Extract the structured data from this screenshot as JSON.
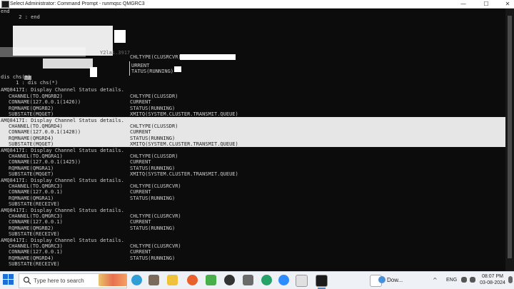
{
  "window": {
    "title": "Select Administrator: Command Prompt - runmqsc  QMGRC3",
    "minimize": "—",
    "maximize": "☐",
    "close": "✕"
  },
  "console": {
    "lines_top": [
      "end",
      "      2 : end",
      "dis chs(*)",
      "     1 : dis chs(*)",
      "AMQ8417I: Display Channel Status details."
    ],
    "blocks": [
      {
        "header": "AMQ8417I: Display Channel Status details.",
        "left": [
          "CHANNEL(TO.QMGRB2)",
          "CONNAME(127.0.0.1(1426))",
          "RQMNAME(QMGRB2)",
          "SUBSTATE(MQGET)"
        ],
        "right": [
          "CHLTYPE(CLUSSDR)",
          "CURRENT",
          "STATUS(RUNNING)",
          "XMITQ(SYSTEM.CLUSTER.TRANSMIT.QUEUE)"
        ]
      },
      {
        "header": "AMQ8417I: Display Channel Status details.",
        "left": [
          "CHANNEL(TO.QMGRD4)",
          "CONNAME(127.0.0.1(1428))",
          "RQMNAME(QMGRD4)",
          "SUBSTATE(MQGET)"
        ],
        "right": [
          "CHLTYPE(CLUSSDR)",
          "CURRENT",
          "STATUS(RUNNING)",
          "XMITQ(SYSTEM.CLUSTER.TRANSMIT.QUEUE)"
        ]
      },
      {
        "header": "AMQ8417I: Display Channel Status details.",
        "left": [
          "CHANNEL(TO.QMGRA1)",
          "CONNAME(127.0.0.1(1425))",
          "RQMNAME(QMGRA1)",
          "SUBSTATE(MQGET)"
        ],
        "right": [
          "CHLTYPE(CLUSSDR)",
          "CURRENT",
          "STATUS(RUNNING)",
          "XMITQ(SYSTEM.CLUSTER.TRANSMIT.QUEUE)"
        ]
      },
      {
        "header": "AMQ8417I: Display Channel Status details.",
        "left": [
          "CHANNEL(TO.QMGRC3)",
          "CONNAME(127.0.0.1)",
          "RQMNAME(QMGRA1)",
          "SUBSTATE(RECEIVE)"
        ],
        "right": [
          "CHLTYPE(CLUSRCVR)",
          "CURRENT",
          "STATUS(RUNNING)",
          ""
        ]
      },
      {
        "header": "AMQ8417I: Display Channel Status details.",
        "left": [
          "CHANNEL(TO.QMGRC3)",
          "CONNAME(127.0.0.1)",
          "RQMNAME(QMGRB2)",
          "SUBSTATE(RECEIVE)"
        ],
        "right": [
          "CHLTYPE(CLUSRCVR)",
          "CURRENT",
          "STATUS(RUNNING)",
          ""
        ]
      },
      {
        "header": "AMQ8417I: Display Channel Status details.",
        "left": [
          "CHANNEL(TO.QMGRC3)",
          "CONNAME(127.0.0.1)",
          "RQMNAME(QMGRD4)",
          "SUBSTATE(RECEIVE)"
        ],
        "right": [
          "CHLTYPE(CLUSRCVR)",
          "CURRENT",
          "STATUS(RUNNING)",
          ""
        ]
      }
    ],
    "partial": {
      "right_top": [
        "CHLTYPE(CLUSRCVR)",
        "URRENT",
        "TATUS(RUNNING)"
      ],
      "faded": "Y2lai.3917"
    }
  },
  "taskbar": {
    "search_placeholder": "Type here to search",
    "weather": "Dow...",
    "tray_chevron": "^",
    "language": "ENG",
    "time": "08:07 PM",
    "date": "03-08-2024"
  },
  "colors": {
    "console_bg": "#0c0c0c",
    "console_text": "#cccccc",
    "selection": "#e6e6e6",
    "accent": "#1e6ed8"
  }
}
